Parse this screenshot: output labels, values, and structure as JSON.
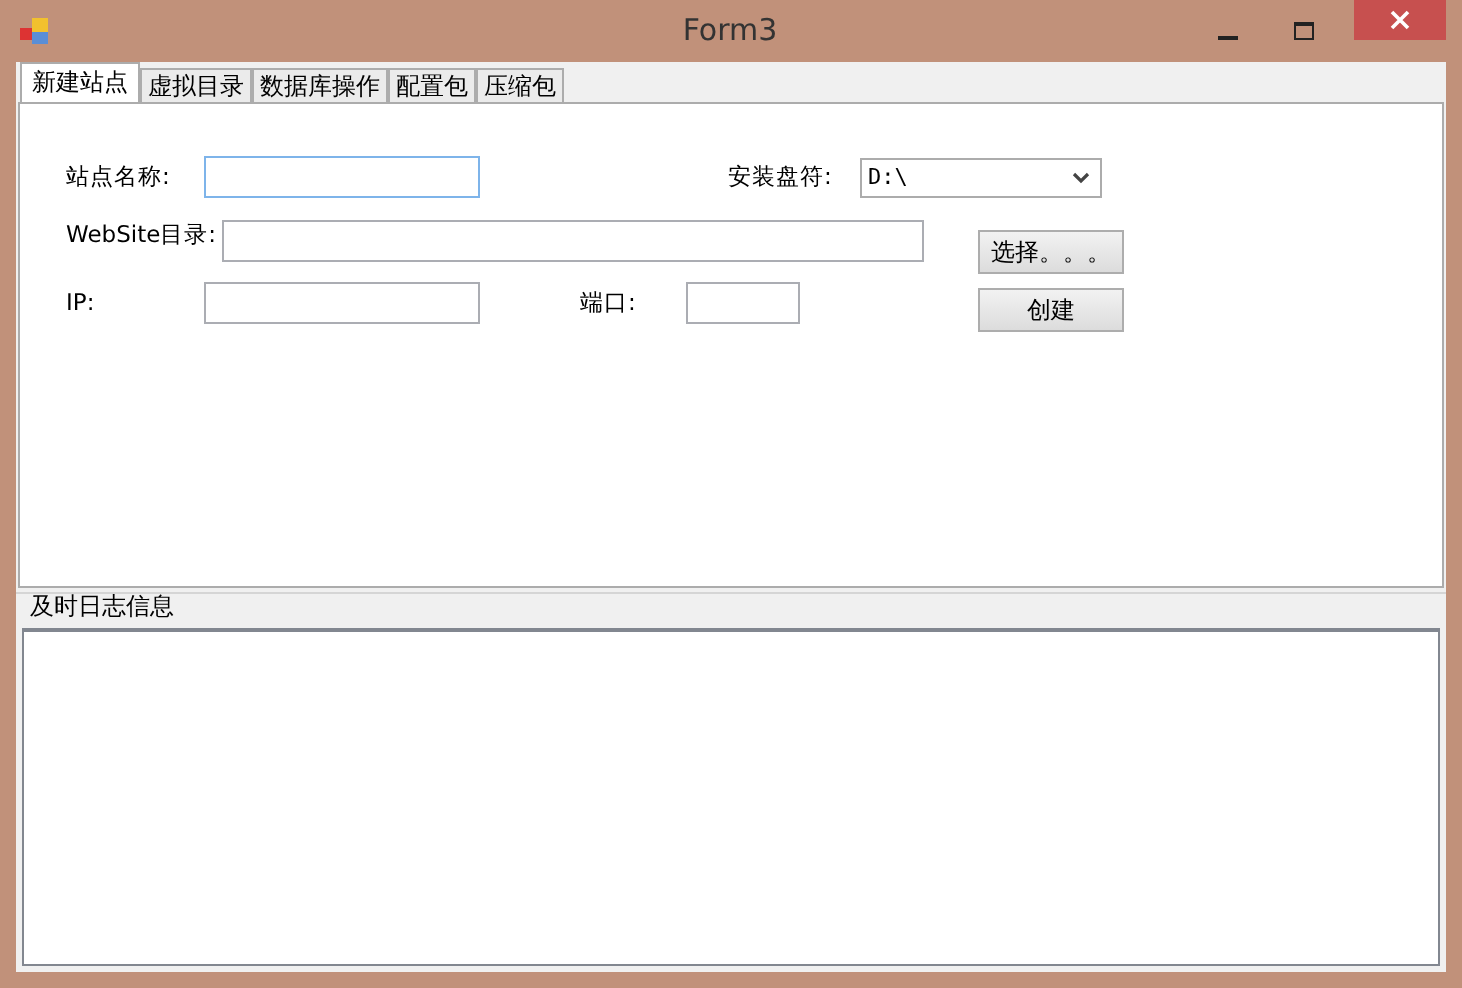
{
  "window": {
    "title": "Form3"
  },
  "tabs": [
    {
      "label": "新建站点",
      "selected": true
    },
    {
      "label": "虚拟目录",
      "selected": false
    },
    {
      "label": "数据库操作",
      "selected": false
    },
    {
      "label": "配置包",
      "selected": false
    },
    {
      "label": "压缩包",
      "selected": false
    }
  ],
  "form": {
    "site_name_label": "站点名称:",
    "drive_label": "安装盘符:",
    "drive_value": "D:\\",
    "website_dir_label": "WebSite目录:",
    "choose_button": "选择。。。",
    "ip_label": "IP:",
    "port_label": "端口:",
    "create_button": "创建"
  },
  "log_group": {
    "title": "及时日志信息"
  }
}
